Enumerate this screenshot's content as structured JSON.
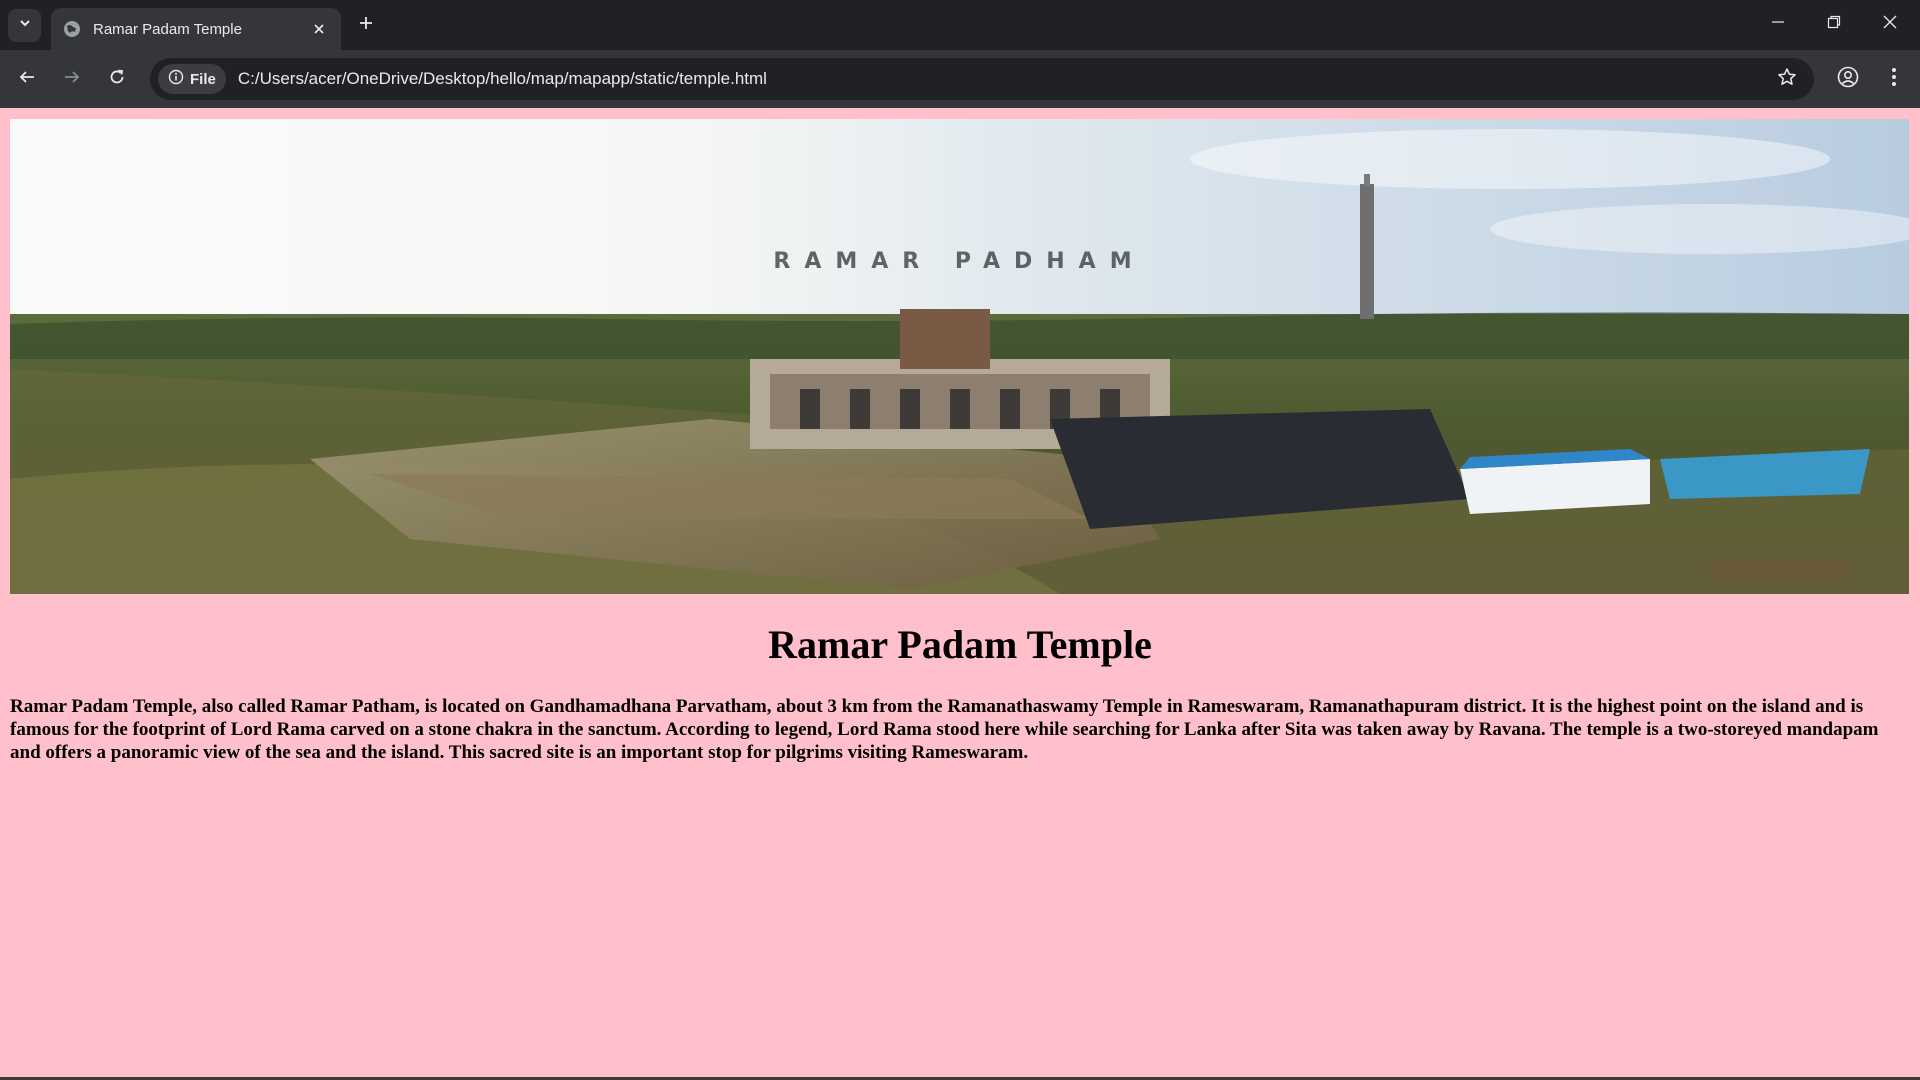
{
  "browser": {
    "tab": {
      "title": "Ramar Padam Temple",
      "favicon": "globe-icon"
    },
    "omnibox": {
      "site_chip_label": "File",
      "url": "C:/Users/acer/OneDrive/Desktop/hello/map/mapapp/static/temple.html"
    },
    "icons": {
      "tab_search": "chevron-down-icon",
      "tab_close": "close-icon",
      "new_tab": "plus-icon",
      "back": "arrow-left-icon",
      "forward": "arrow-right-icon",
      "reload": "reload-icon",
      "site_info": "info-icon",
      "bookmark": "star-icon",
      "profile": "profile-icon",
      "menu": "more-vertical-icon",
      "minimize": "minimize-icon",
      "maximize": "restore-icon",
      "close": "window-close-icon"
    },
    "colors": {
      "chrome_dark": "#202124",
      "chrome_toolbar": "#35363a"
    }
  },
  "page": {
    "background_color": "#ffc0cb",
    "hero_image_caption": "RAMAR PADHAM",
    "title": "Ramar Padam Temple",
    "description": "Ramar Padam Temple, also called Ramar Patham, is located on Gandhamadhana Parvatham, about 3 km from the Ramanathaswamy Temple in Rameswaram, Ramanathapuram district. It is the highest point on the island and is famous for the footprint of Lord Rama carved on a stone chakra in the sanctum. According to legend, Lord Rama stood here while searching for Lanka after Sita was taken away by Ravana. The temple is a two-storeyed mandapam and offers a panoramic view of the sea and the island. This sacred site is an important stop for pilgrims visiting Rameswaram."
  }
}
